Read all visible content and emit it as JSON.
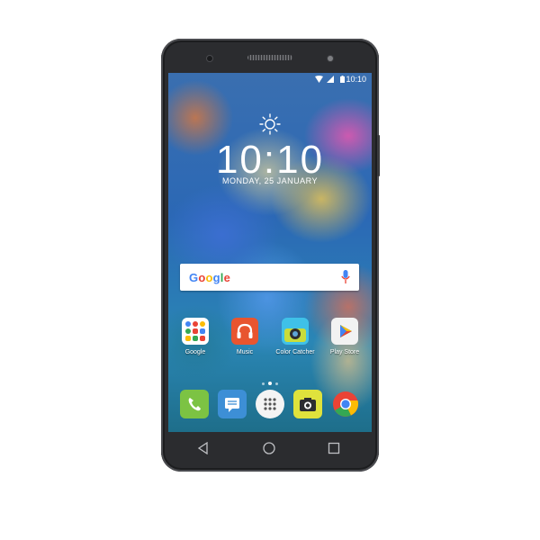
{
  "status_bar": {
    "time": "10:10",
    "icons": [
      "wifi-icon",
      "signal-icon",
      "battery-icon"
    ]
  },
  "lockscreen": {
    "weather_icon": "sun-icon",
    "clock": "10:10",
    "date": "MONDAY,  25 JANUARY"
  },
  "search_bar": {
    "logo_text": "Google",
    "mic_icon": "microphone-icon"
  },
  "apps": [
    {
      "label": "Google"
    },
    {
      "label": "Music"
    },
    {
      "label": "Color Catcher"
    },
    {
      "label": "Play Store"
    }
  ],
  "page_indicator": {
    "pages": 3,
    "current": 2
  },
  "dock": [
    {
      "icon": "phone-icon"
    },
    {
      "icon": "messages-icon"
    },
    {
      "icon": "app-drawer-icon"
    },
    {
      "icon": "camera-icon"
    },
    {
      "icon": "chrome-icon"
    }
  ],
  "nav_buttons": [
    "back-icon",
    "home-icon",
    "recents-icon"
  ],
  "colors": {
    "phone_body": "#2b2c2f",
    "phone_icon_green": "#7cc343",
    "messages_blue": "#3d8fd6",
    "camera_yellow": "#dfe23c",
    "music_orange": "#e8552f"
  }
}
